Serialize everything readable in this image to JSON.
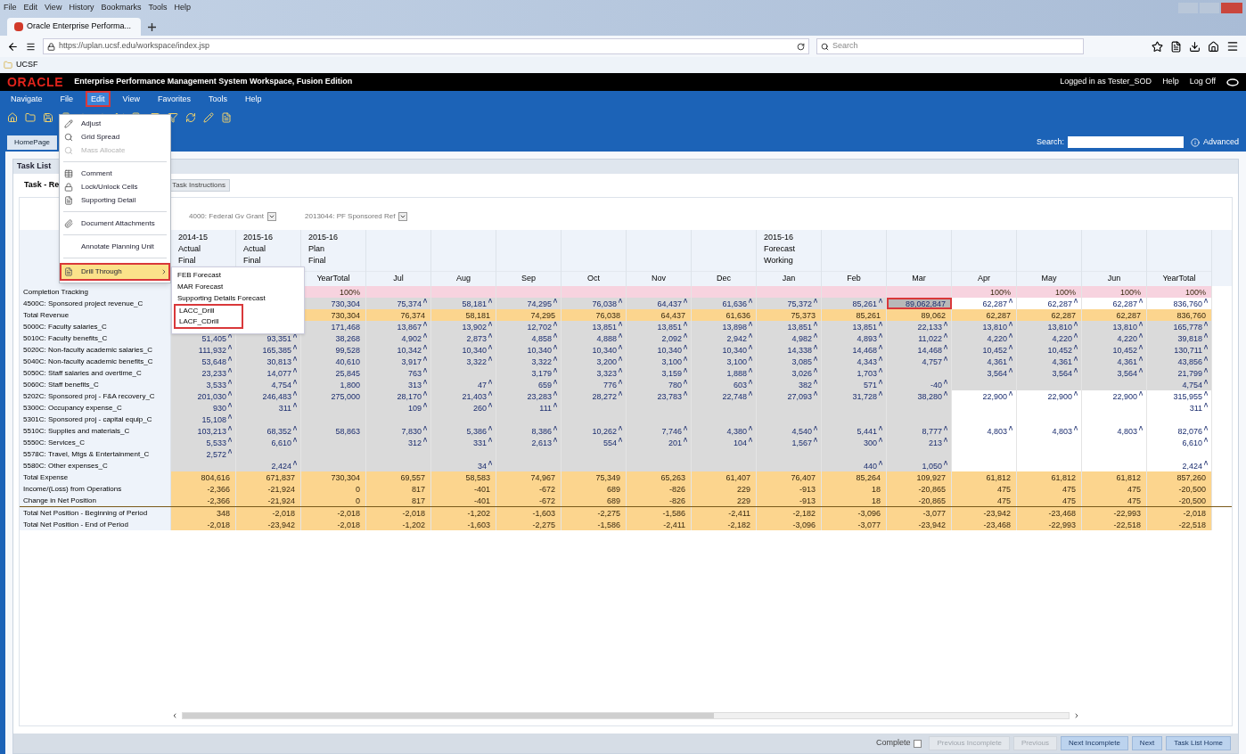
{
  "browser": {
    "menu": [
      "File",
      "Edit",
      "View",
      "History",
      "Bookmarks",
      "Tools",
      "Help"
    ],
    "tab": "Oracle Enterprise Performa...",
    "url": "https://uplan.ucsf.edu/workspace/index.jsp",
    "search_placeholder": "Search",
    "bookmark": "UCSF"
  },
  "header": {
    "logo": "ORACLE",
    "title": "Enterprise Performance Management System Workspace, Fusion Edition",
    "user": "Logged in as Tester_SOD",
    "links": [
      "Help",
      "Log Off"
    ]
  },
  "menubar": [
    {
      "label": "Navigate",
      "selected": false
    },
    {
      "label": "File",
      "selected": false
    },
    {
      "label": "Edit",
      "selected": true
    },
    {
      "label": "View",
      "selected": false
    },
    {
      "label": "Favorites",
      "selected": false
    },
    {
      "label": "Tools",
      "selected": false
    },
    {
      "label": "Help",
      "selected": false
    }
  ],
  "search": {
    "label": "Search:",
    "advanced": "Advanced"
  },
  "tabs": [
    {
      "label": "HomePage",
      "selected": true
    }
  ],
  "panel": {
    "title": "Task List",
    "task": "Task - Re",
    "instructions_button": "Task Instructions",
    "pov": [
      "4000: Federal Gv Grant",
      "2013044: PF Sponsored Ref"
    ]
  },
  "edit_menu": [
    {
      "kind": "item",
      "label": "Adjust",
      "disabled": false,
      "selected": false
    },
    {
      "kind": "item",
      "label": "Grid Spread",
      "disabled": false,
      "selected": false
    },
    {
      "kind": "item",
      "label": "Mass Allocate",
      "disabled": true,
      "selected": false
    },
    {
      "kind": "separator"
    },
    {
      "kind": "item",
      "label": "Comment",
      "disabled": false,
      "selected": false
    },
    {
      "kind": "item",
      "label": "Lock/Unlock Cells",
      "disabled": false,
      "selected": false
    },
    {
      "kind": "item",
      "label": "Supporting Detail",
      "disabled": false,
      "selected": false
    },
    {
      "kind": "separator"
    },
    {
      "kind": "item",
      "label": "Document Attachments",
      "disabled": false,
      "selected": false
    },
    {
      "kind": "separator"
    },
    {
      "kind": "item",
      "label": "Annotate Planning Unit",
      "disabled": false,
      "selected": false
    },
    {
      "kind": "separator"
    },
    {
      "kind": "item",
      "label": "Drill Through",
      "disabled": false,
      "selected": true,
      "submenu": true
    }
  ],
  "submenu": [
    {
      "label": "FEB Forecast",
      "annotated": false
    },
    {
      "label": "MAR Forecast",
      "annotated": false
    },
    {
      "label": "Supporting Details Forecast",
      "annotated": false
    },
    {
      "label": "LACC_Drill",
      "annotated": true
    },
    {
      "label": "LACF_CDrill",
      "annotated": true
    }
  ],
  "grid": {
    "columns": [
      {
        "lines": [
          "2014-15",
          "Actual",
          "Final"
        ]
      },
      {
        "lines": [
          "2015-16",
          "Actual",
          "Final"
        ]
      },
      {
        "lines": [
          "2015-16",
          "Plan",
          "Final"
        ],
        "period": "YearTotal"
      },
      {
        "period": "Jul"
      },
      {
        "period": "Aug"
      },
      {
        "period": "Sep"
      },
      {
        "period": "Oct"
      },
      {
        "period": "Nov"
      },
      {
        "period": "Dec"
      },
      {
        "lines": [
          "2015-16",
          "Forecast",
          "Working"
        ],
        "period": "Jan"
      },
      {
        "period": "Feb"
      },
      {
        "period": "Mar"
      },
      {
        "period": "Apr"
      },
      {
        "period": "May"
      },
      {
        "period": "Jun"
      },
      {
        "period": "YearTotal"
      }
    ],
    "rows": [
      {
        "label": "Completion Tracking",
        "kind": "tracking",
        "cells": [
          null,
          null,
          "100%",
          null,
          null,
          null,
          null,
          null,
          null,
          null,
          null,
          null,
          "100%",
          "100%",
          "100%",
          "100%"
        ]
      },
      {
        "label": "4500C: Sponsored project revenue_C",
        "kind": "input",
        "open_forecast": true,
        "cells": [
          null,
          null,
          "730,304",
          "75,374",
          "58,181",
          "74,295",
          "76,038",
          "64,437",
          "61,636",
          "75,372",
          "85,261",
          {
            "value": "89,062,847",
            "selected": true
          },
          "62,287",
          "62,287",
          "62,287",
          "836,760"
        ]
      },
      {
        "label": "Total Revenue",
        "kind": "total",
        "cells": [
          null,
          null,
          "730,304",
          "76,374",
          "58,181",
          "74,295",
          "76,038",
          "64,437",
          "61,636",
          "75,373",
          "85,261",
          "89,062",
          "62,287",
          "62,287",
          "62,287",
          "836,760"
        ]
      },
      {
        "label": "5000C: Faculty salaries_C",
        "kind": "input",
        "open_forecast": false,
        "cells": [
          null,
          null,
          "171,468",
          "13,867",
          "13,902",
          "12,702",
          "13,851",
          "13,851",
          "13,898",
          "13,851",
          "13,851",
          "22,133",
          "13,810",
          "13,810",
          "13,810",
          "165,778"
        ]
      },
      {
        "label": "5010C: Faculty benefits_C",
        "kind": "input",
        "open_forecast": false,
        "cells": [
          "51,405",
          "93,351",
          "38,268",
          "4,902",
          "2,873",
          "4,858",
          "4,888",
          "2,092",
          "2,942",
          "4,982",
          "4,893",
          "11,022",
          "4,220",
          "4,220",
          "4,220",
          "39,818"
        ]
      },
      {
        "label": "5020C: Non-faculty academic salaries_C",
        "kind": "input",
        "open_forecast": false,
        "cells": [
          "111,932",
          "165,385",
          "99,528",
          "10,342",
          "10,340",
          "10,340",
          "10,340",
          "10,340",
          "10,340",
          "14,338",
          "14,468",
          "14,468",
          "10,452",
          "10,452",
          "10,452",
          "130,711"
        ]
      },
      {
        "label": "5040C: Non-faculty academic benefits_C",
        "kind": "input",
        "open_forecast": false,
        "cells": [
          "53,648",
          "30,813",
          "40,610",
          "3,917",
          "3,322",
          "3,322",
          "3,200",
          "3,100",
          "3,100",
          "3,085",
          "4,343",
          "4,757",
          "4,361",
          "4,361",
          "4,361",
          "43,856"
        ]
      },
      {
        "label": "5050C: Staff salaries and overtime_C",
        "kind": "input",
        "open_forecast": false,
        "cells": [
          "23,233",
          "14,077",
          "25,845",
          "763",
          null,
          "3,179",
          "3,323",
          "3,159",
          "1,888",
          "3,026",
          "1,703",
          null,
          "3,564",
          "3,564",
          "3,564",
          "21,799"
        ]
      },
      {
        "label": "5060C: Staff benefits_C",
        "kind": "input",
        "open_forecast": false,
        "cells": [
          "3,533",
          "4,754",
          "1,800",
          "313",
          "47",
          "659",
          "776",
          "780",
          "603",
          "382",
          "571",
          "-40",
          null,
          null,
          null,
          "4,754"
        ]
      },
      {
        "label": "5202C: Sponsored proj - F&A recovery_C",
        "kind": "input",
        "open_forecast": true,
        "cells": [
          "201,030",
          "246,483",
          "275,000",
          "28,170",
          "21,403",
          "23,283",
          "28,272",
          "23,783",
          "22,748",
          "27,093",
          "31,728",
          "38,280",
          "22,900",
          "22,900",
          "22,900",
          "315,955"
        ]
      },
      {
        "label": "5300C: Occupancy expense_C",
        "kind": "input",
        "open_forecast": true,
        "cells": [
          "930",
          "311",
          null,
          "109",
          "260",
          "111",
          null,
          null,
          null,
          null,
          null,
          null,
          null,
          null,
          null,
          "311"
        ]
      },
      {
        "label": "5301C: Sponsored proj - capital equip_C",
        "kind": "input",
        "open_forecast": true,
        "cells": [
          "15,108",
          null,
          null,
          null,
          null,
          null,
          null,
          null,
          null,
          null,
          null,
          null,
          null,
          null,
          null,
          null
        ]
      },
      {
        "label": "5510C: Supplies and materials_C",
        "kind": "input",
        "open_forecast": true,
        "cells": [
          "103,213",
          "68,352",
          "58,863",
          "7,830",
          "5,386",
          "8,386",
          "10,262",
          "7,746",
          "4,380",
          "4,540",
          "5,441",
          "8,777",
          "4,803",
          "4,803",
          "4,803",
          "82,076"
        ]
      },
      {
        "label": "5550C: Services_C",
        "kind": "input",
        "open_forecast": true,
        "cells": [
          "5,533",
          "6,610",
          null,
          "312",
          "331",
          "2,613",
          "554",
          "201",
          "104",
          "1,567",
          "300",
          "213",
          null,
          null,
          null,
          "6,610"
        ]
      },
      {
        "label": "5578C: Travel, Mtgs & Entertainment_C",
        "kind": "input",
        "open_forecast": true,
        "cells": [
          "2,572",
          null,
          null,
          null,
          null,
          null,
          null,
          null,
          null,
          null,
          null,
          null,
          null,
          null,
          null,
          null
        ]
      },
      {
        "label": "5580C: Other expenses_C",
        "kind": "input",
        "open_forecast": true,
        "cells": [
          null,
          "2,424",
          null,
          null,
          "34",
          null,
          null,
          null,
          null,
          null,
          "440",
          "1,050",
          null,
          null,
          null,
          "2,424"
        ]
      },
      {
        "label": "Total Expense",
        "kind": "total",
        "cells": [
          "804,616",
          "671,837",
          "730,304",
          "69,557",
          "58,583",
          "74,967",
          "75,349",
          "65,263",
          "61,407",
          "76,407",
          "85,264",
          "109,927",
          "61,812",
          "61,812",
          "61,812",
          "857,260"
        ]
      },
      {
        "label": "Income/(Loss) from Operations",
        "kind": "total",
        "cells": [
          "-2,366",
          "-21,924",
          "0",
          "817",
          "-401",
          "-672",
          "689",
          "-826",
          "229",
          "-913",
          "18",
          "-20,865",
          "475",
          "475",
          "475",
          "-20,500"
        ]
      },
      {
        "label": "Change in Net Position",
        "kind": "total",
        "cells": [
          "-2,366",
          "-21,924",
          "0",
          "817",
          "-401",
          "-672",
          "689",
          "-826",
          "229",
          "-913",
          "18",
          "-20,865",
          "475",
          "475",
          "475",
          "-20,500"
        ]
      },
      {
        "label": "Total Net Position - Beginning of Period",
        "kind": "position",
        "cells": [
          "348",
          "-2,018",
          "-2,018",
          "-2,018",
          "-1,202",
          "-1,603",
          "-2,275",
          "-1,586",
          "-2,411",
          "-2,182",
          "-3,096",
          "-3,077",
          "-23,942",
          "-23,468",
          "-22,993",
          "-2,018"
        ]
      },
      {
        "label": "Total Net Position - End of Period",
        "kind": "position",
        "cells": [
          "-2,018",
          "-23,942",
          "-2,018",
          "-1,202",
          "-1,603",
          "-2,275",
          "-1,586",
          "-2,411",
          "-2,182",
          "-3,096",
          "-3,077",
          "-23,942",
          "-23,468",
          "-22,993",
          "-22,518",
          "-22,518"
        ]
      }
    ]
  },
  "footer": {
    "complete_label": "Complete",
    "complete_checked": false,
    "buttons": [
      {
        "label": "Previous Incomplete",
        "disabled": true
      },
      {
        "label": "Previous",
        "disabled": true
      },
      {
        "label": "Next Incomplete",
        "disabled": false
      },
      {
        "label": "Next",
        "disabled": false
      },
      {
        "label": "Task List Home",
        "disabled": false
      }
    ]
  }
}
